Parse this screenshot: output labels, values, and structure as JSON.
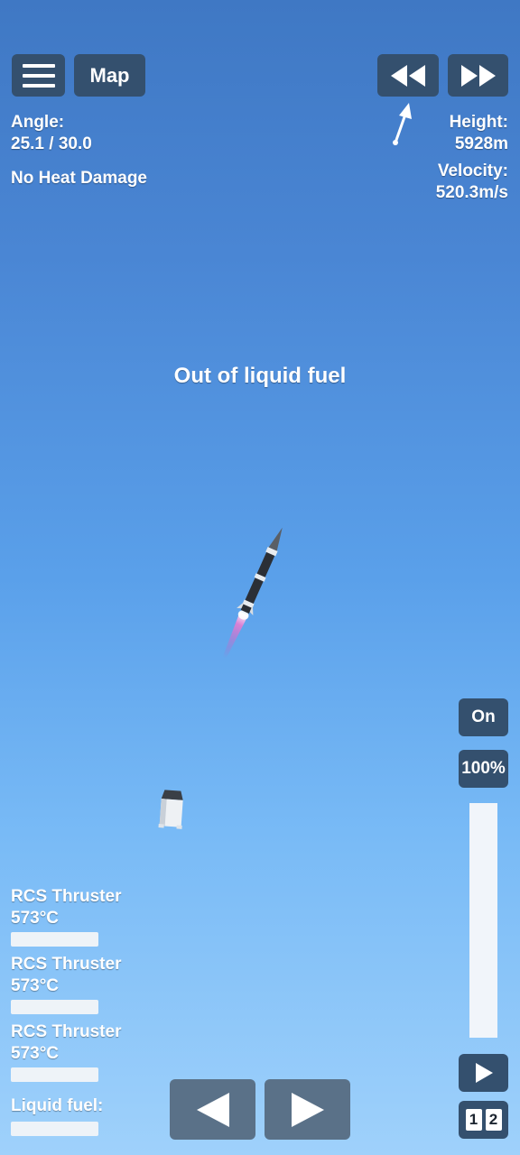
{
  "toolbar": {
    "map_label": "Map",
    "menu_icon": "hamburger-menu-icon",
    "rewind_icon": "rewind-icon",
    "fast_forward_icon": "fast-forward-icon"
  },
  "telemetry": {
    "angle_label": "Angle:",
    "angle_value": "25.1 / 30.0",
    "heat_status": "No Heat Damage",
    "height_label": "Height:",
    "height_value": "5928m",
    "velocity_label": "Velocity:",
    "velocity_value": "520.3m/s",
    "direction_icon": "direction-arrow-icon"
  },
  "message": "Out of liquid fuel",
  "throttle": {
    "engine_toggle_label": "On",
    "throttle_label": "100%",
    "throttle_level": 1.0,
    "play_icon": "play-icon"
  },
  "stages": [
    "1",
    "2"
  ],
  "parts": [
    {
      "name": "RCS Thruster",
      "temp": "573°C"
    },
    {
      "name": "RCS Thruster",
      "temp": "573°C"
    },
    {
      "name": "RCS Thruster",
      "temp": "573°C"
    }
  ],
  "fuel": {
    "label": "Liquid fuel:",
    "level": 0.0
  },
  "controls": {
    "rotate_left_icon": "arrow-left-icon",
    "rotate_right_icon": "arrow-right-icon"
  },
  "colors": {
    "button_bg": "#34506e",
    "control_bg": "#5a7188",
    "sky_top": "#3f78c4",
    "sky_bottom": "#9fd1fb"
  }
}
